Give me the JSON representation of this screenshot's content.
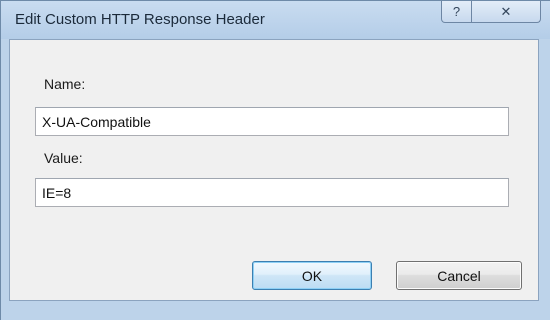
{
  "window": {
    "title": "Edit Custom HTTP Response Header",
    "help_glyph": "?",
    "close_glyph": "✕"
  },
  "form": {
    "name_label": "Name:",
    "name_value": "X-UA-Compatible",
    "value_label": "Value:",
    "value_value": "IE=8"
  },
  "buttons": {
    "ok_label": "OK",
    "cancel_label": "Cancel"
  },
  "icons": {
    "help": "help-icon",
    "close": "close-icon"
  }
}
